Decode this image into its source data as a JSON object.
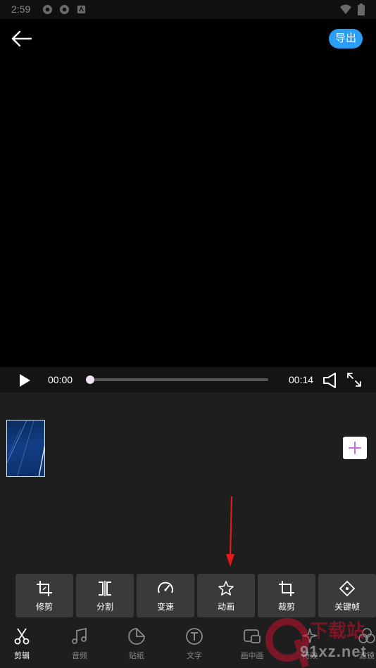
{
  "status_bar": {
    "time": "2:59",
    "icons": [
      "notification-icon",
      "notification-icon",
      "app-icon"
    ],
    "right_icons": [
      "wifi-icon",
      "battery-icon"
    ]
  },
  "header": {
    "back_icon": "arrow-left-icon",
    "export_label": "导出",
    "accent": "#2a9df4"
  },
  "player": {
    "current_time": "00:00",
    "total_time": "00:14",
    "progress": 0.0
  },
  "timeline": {
    "clip_count": 1,
    "add_icon": "plus-icon"
  },
  "tools": [
    {
      "label": "修剪",
      "icon": "crop-icon"
    },
    {
      "label": "分割",
      "icon": "split-icon"
    },
    {
      "label": "变速",
      "icon": "speedometer-icon"
    },
    {
      "label": "动画",
      "icon": "star-icon"
    },
    {
      "label": "裁剪",
      "icon": "crop-icon"
    },
    {
      "label": "关键帧",
      "icon": "keyframe-icon"
    }
  ],
  "bottom_nav": [
    {
      "label": "剪辑",
      "icon": "scissors-icon",
      "active": true
    },
    {
      "label": "音频",
      "icon": "music-icon"
    },
    {
      "label": "贴纸",
      "icon": "sticker-icon"
    },
    {
      "label": "文字",
      "icon": "text-icon"
    },
    {
      "label": "画中画",
      "icon": "picture-in-picture-icon"
    },
    {
      "label": "特效",
      "icon": "effects-icon"
    },
    {
      "label": "滤镜",
      "icon": "filter-icon"
    }
  ],
  "watermark": {
    "text": "91xz.net",
    "logo_text": "下载站"
  }
}
